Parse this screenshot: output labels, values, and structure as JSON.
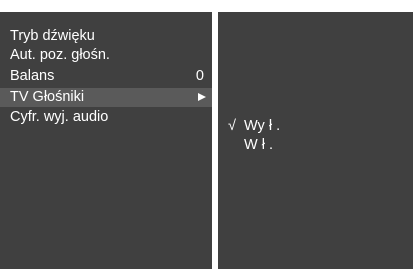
{
  "menu": {
    "items": [
      {
        "label": "Tryb dźwięku",
        "value": ""
      },
      {
        "label": "Aut. poz. głośn.",
        "value": ""
      },
      {
        "label": "Balans",
        "value": "0"
      },
      {
        "label": "TV Głośniki",
        "value": "",
        "selected": true,
        "has_submenu": true
      },
      {
        "label": "Cyfr. wyj. audio",
        "value": ""
      }
    ]
  },
  "submenu": {
    "options": [
      {
        "check": "√",
        "label": "Wy ł .",
        "checked": true
      },
      {
        "check": "",
        "label": "W ł .",
        "checked": false
      }
    ]
  },
  "colors": {
    "panel_background": "#404040",
    "selected_row": "#5a5a5a",
    "text": "#ffffff",
    "frame": "#ffffff"
  },
  "icons": {
    "submenu_indicator": "triangle-right-icon",
    "checkmark": "check-icon"
  }
}
